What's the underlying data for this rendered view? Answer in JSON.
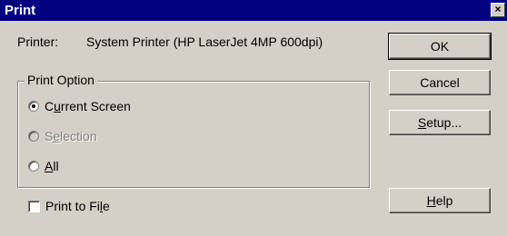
{
  "window": {
    "title": "Print",
    "close_glyph": "×"
  },
  "printer": {
    "label": "Printer:",
    "name": "System Printer (HP LaserJet 4MP 600dpi)"
  },
  "print_option": {
    "legend": "Print Option",
    "options": [
      {
        "pre": "C",
        "ul": "u",
        "post": "rrent Screen",
        "state": "checked"
      },
      {
        "pre": "S",
        "ul": "e",
        "post": "lection",
        "state": "disabled"
      },
      {
        "pre": "",
        "ul": "A",
        "post": "ll",
        "state": "unchecked"
      }
    ]
  },
  "print_to_file": {
    "pre": "Print to Fi",
    "ul": "l",
    "post": "e",
    "checked": false
  },
  "buttons": {
    "ok": {
      "label": "OK"
    },
    "cancel": {
      "label": "Cancel"
    },
    "setup": {
      "pre": "",
      "ul": "S",
      "post": "etup..."
    },
    "help": {
      "pre": "",
      "ul": "H",
      "post": "elp"
    }
  }
}
